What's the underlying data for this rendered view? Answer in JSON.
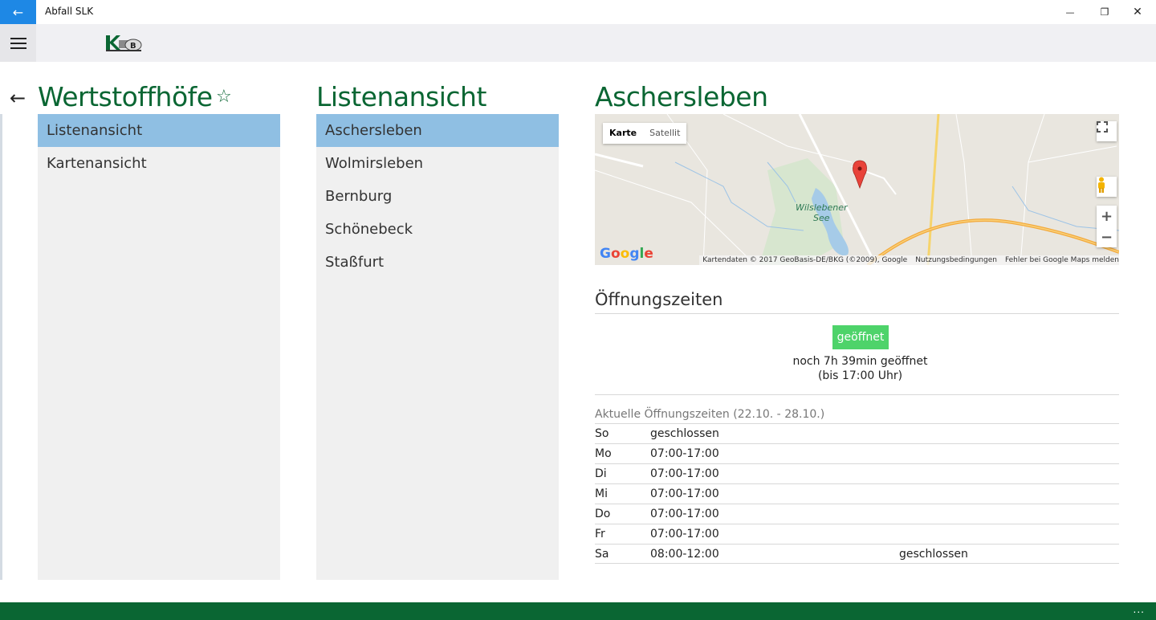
{
  "window": {
    "title": "Abfall SLK",
    "back_glyph": "←",
    "minimize_glyph": "—",
    "restore_glyph": "❐",
    "close_glyph": "✕"
  },
  "nav": {
    "back_glyph": "←"
  },
  "column1": {
    "title": "Wertstoffhöfe",
    "star_glyph": "☆",
    "items": [
      {
        "label": "Listenansicht",
        "selected": true
      },
      {
        "label": "Kartenansicht",
        "selected": false
      }
    ]
  },
  "column2": {
    "title": "Listenansicht",
    "items": [
      {
        "label": "Aschersleben",
        "selected": true
      },
      {
        "label": "Wolmirsleben",
        "selected": false
      },
      {
        "label": "Bernburg",
        "selected": false
      },
      {
        "label": "Schönebeck",
        "selected": false
      },
      {
        "label": "Staßfurt",
        "selected": false
      }
    ]
  },
  "detail": {
    "title": "Aschersleben",
    "map": {
      "type_map": "Karte",
      "type_satellite": "Satellit",
      "lake_label_line1": "Wilslebener",
      "lake_label_line2": "See",
      "attribution": "Kartendaten © 2017 GeoBasis-DE/BKG (©2009), Google",
      "terms": "Nutzungsbedingungen",
      "report": "Fehler bei Google Maps melden",
      "zoom_in": "+",
      "zoom_out": "−",
      "google_letters": [
        "G",
        "o",
        "o",
        "g",
        "l",
        "e"
      ]
    },
    "opening_title": "Öffnungszeiten",
    "status": "geöffnet",
    "remaining_line1": "noch 7h 39min geöffnet",
    "remaining_line2": "(bis 17:00 Uhr)",
    "week_title": "Aktuelle Öffnungszeiten (22.10. - 28.10.)",
    "hours": [
      {
        "day": "So",
        "time": "geschlossen",
        "extra": ""
      },
      {
        "day": "Mo",
        "time": "07:00-17:00",
        "extra": ""
      },
      {
        "day": "Di",
        "time": "07:00-17:00",
        "extra": ""
      },
      {
        "day": "Mi",
        "time": "07:00-17:00",
        "extra": ""
      },
      {
        "day": "Do",
        "time": "07:00-17:00",
        "extra": ""
      },
      {
        "day": "Fr",
        "time": "07:00-17:00",
        "extra": ""
      },
      {
        "day": "Sa",
        "time": "08:00-12:00",
        "extra": "geschlossen"
      }
    ]
  },
  "footer": {
    "more_glyph": "..."
  },
  "colors": {
    "accent_green": "#0a6633",
    "selected_blue": "#8fbfe3",
    "status_green": "#4ed36a",
    "titlebar_blue": "#1e88e5"
  }
}
